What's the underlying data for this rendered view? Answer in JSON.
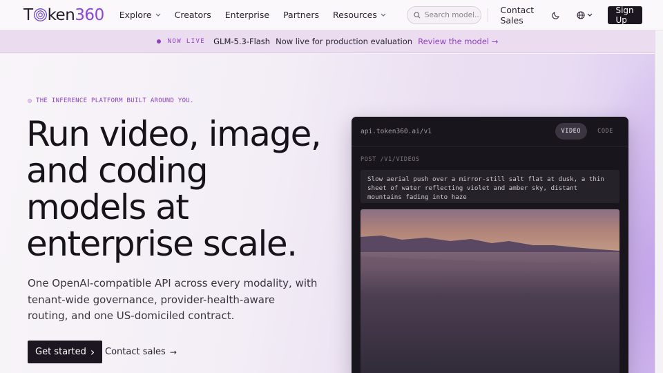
{
  "brand": {
    "logo_pre": "T",
    "logo_mid": "ken",
    "logo_num": "360"
  },
  "nav": {
    "links": [
      {
        "label": "Explore",
        "dropdown": true
      },
      {
        "label": "Creators",
        "dropdown": false
      },
      {
        "label": "Enterprise",
        "dropdown": false
      },
      {
        "label": "Partners",
        "dropdown": false
      },
      {
        "label": "Resources",
        "dropdown": true
      }
    ],
    "search_placeholder": "Search model...",
    "contact_label": "Contact Sales",
    "theme_icon": "moon-icon",
    "language_icon": "globe-icon",
    "signup_label": "Sign Up"
  },
  "banner": {
    "badge": "NOW LIVE",
    "model": "GLM-5.3-Flash",
    "message": "Now live for production evaluation",
    "link_label": "Review the model",
    "link_arrow": "→"
  },
  "hero": {
    "eyebrow": "THE INFERENCE PLATFORM BUILT AROUND YOU.",
    "headline": "Run video, image, and coding models at enterprise scale.",
    "subheadline": "One OpenAI-compatible API across every modality, with tenant-wide governance, provider-health-aware routing, and one US-domiciled contract.",
    "cta_primary": "Get started",
    "cta_primary_icon": "›",
    "cta_secondary": "Contact sales",
    "cta_secondary_icon": "→"
  },
  "api_card": {
    "endpoint": "api.token360.ai/v1",
    "tabs": [
      {
        "label": "VIDEO",
        "active": true
      },
      {
        "label": "CODE",
        "active": false
      }
    ],
    "route": "POST /V1/VIDEOS",
    "prompt": "Slow aerial push over a mirror-still salt flat at dusk, a thin sheet of water reflecting violet and amber sky, distant mountains fading into haze"
  },
  "colors": {
    "accent": "#8d3fc4",
    "dark": "#1b1620",
    "banner_bg": "#ecdcf0",
    "card_bg": "#18151c"
  }
}
